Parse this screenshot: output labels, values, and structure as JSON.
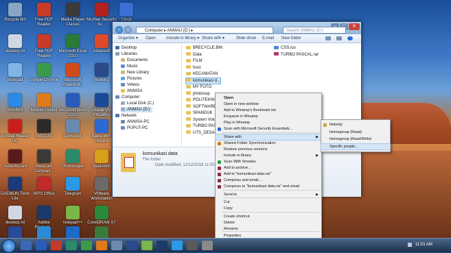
{
  "desktop": {
    "icons": [
      {
        "label": "Recycle Bin",
        "color": "#8aa4c4"
      },
      {
        "label": "Free PDF Reader",
        "color": "#c83a2a"
      },
      {
        "label": "Media Player Classic",
        "color": "#3a3a3a"
      },
      {
        "label": "McAfee Security Sc...",
        "color": "#b42020"
      },
      {
        "label": "Clock",
        "color": "#3a6fd6"
      },
      {
        "label": "desktop.ini",
        "color": "#cfd8e2"
      },
      {
        "label": "Free PDF Reader",
        "color": "#c83a2a"
      },
      {
        "label": "Microsoft Excel 2010",
        "color": "#2a7a3a"
      },
      {
        "label": "Aiseesoft",
        "color": "#e04a2a"
      },
      {
        "label": "Notepad",
        "color": "#7fb6e6"
      },
      {
        "label": "Google Chrome",
        "color": "#3a9a4a"
      },
      {
        "label": "Microsoft PowerPoi...",
        "color": "#d04a1a"
      },
      {
        "label": "Booking",
        "color": "#2a4a8a"
      },
      {
        "label": "SHAREit",
        "color": "#2a8ae6"
      },
      {
        "label": "Mozilla Firefox",
        "color": "#e07a1a"
      },
      {
        "label": "Microsoft Word 2010",
        "color": "#2a5aba"
      },
      {
        "label": "Oracle VM VirtualBox",
        "color": "#1a4a9a"
      },
      {
        "label": "Acrobat Reader DC",
        "color": "#c81e1e"
      },
      {
        "label": "SMADAV",
        "color": "#2a2a2a"
      },
      {
        "label": "Computer",
        "color": "#6a8ab0"
      },
      {
        "label": "Baidu WiFi Hotspot",
        "color": "#2a6ad6"
      },
      {
        "label": "AudioWizard",
        "color": "#5a1a1a"
      },
      {
        "label": "WebCam Compani...",
        "color": "#3a3a3a"
      },
      {
        "label": "Photoscape",
        "color": "#2a8a6a"
      },
      {
        "label": "BaiduWifi",
        "color": "#d6a01a"
      },
      {
        "label": "DAEMON Tools Lite",
        "color": "#1a3a7a"
      },
      {
        "label": "WPS Office",
        "color": "#c02a2a"
      },
      {
        "label": "Telegram",
        "color": "#2a9ae6"
      },
      {
        "label": "VMware Workstation",
        "color": "#6a6a6a"
      },
      {
        "label": "desktop.ini",
        "color": "#cfd8e2"
      },
      {
        "label": "Adobe Photosh...",
        "color": "#1a3a6a"
      },
      {
        "label": "notepad++",
        "color": "#7ab64a"
      },
      {
        "label": "CorelDRAW X7",
        "color": "#2a8a3a"
      },
      {
        "label": "EPSON Manuals",
        "color": "#2a4a9a"
      },
      {
        "label": "Internet Downlo...",
        "color": "#2a8ad6"
      },
      {
        "label": "Internet Explorer",
        "color": "#1a6ac6"
      },
      {
        "label": "Corel PHOTO-P...",
        "color": "#3a7a3a"
      }
    ]
  },
  "window": {
    "address": "Computer ▸ ANMAU (D:) ▸",
    "search_placeholder": "Search ANMAU (D:)",
    "toolbar": [
      "Organize ▾",
      "Open",
      "Include in library ▾",
      "Share with ▾",
      "Slide show",
      "E-mail",
      "New folder"
    ],
    "nav": [
      {
        "label": "Desktop",
        "color": "#3a6ab6"
      },
      {
        "label": "Libraries",
        "color": "#8a9ab6"
      },
      {
        "label": "Documents",
        "color": "#c9b67a"
      },
      {
        "label": "Music",
        "color": "#6a8ad6"
      },
      {
        "label": "New Library",
        "color": "#c9b67a"
      },
      {
        "label": "Pictures",
        "color": "#6aa6d6"
      },
      {
        "label": "Videos",
        "color": "#6a8ab6"
      },
      {
        "label": "ANNISA",
        "color": "#e6c25a"
      },
      {
        "label": "Computer",
        "color": "#6a8ab0"
      },
      {
        "label": "Local Disk (C:)",
        "color": "#9aaac0"
      },
      {
        "label": "ANMAU (D:)",
        "color": "#9aaac0"
      },
      {
        "label": "Network",
        "color": "#4a7ab6"
      },
      {
        "label": "ANNISA-PC",
        "color": "#6a8ab0"
      },
      {
        "label": "PUPUT-PC",
        "color": "#6a8ab0"
      }
    ],
    "files_col1": [
      "$RECYCLE.BIN",
      "Data",
      "FILM",
      "host",
      "KECAMATAN",
      "komunikasi d...",
      "MY FOTO",
      "photosop",
      "POLITEKNIK S",
      "SOFTWARE",
      "SPANDUK",
      "System Volum",
      "TURBO PASCA",
      "UTS_DESAIN"
    ],
    "files_col2": [
      "CSS.ico",
      "TURBO PASCAL.rar"
    ],
    "details": {
      "name": "komunikasi data",
      "type": "File folder",
      "modified": "Date modified: 12/12/2018 11:50"
    }
  },
  "context_menu": {
    "items": [
      "Open",
      "Open in new window",
      "Add to Winamp's Bookmark list",
      "Enqueue in Winamp",
      "Play in Winamp",
      "Scan with Microsoft Security Essentials...",
      "Share with",
      "Shared Folder Synchronization",
      "Restore previous versions",
      "Include in library",
      "Scan With Smadav",
      "Add to archive...",
      "Add to \"komunikasi data.rar\"",
      "Compress and email...",
      "Compress to \"komunikasi data.rar\" and email",
      "Send to",
      "Cut",
      "Copy",
      "Create shortcut",
      "Delete",
      "Rename",
      "Properties"
    ]
  },
  "share_submenu": {
    "items": [
      "Nobody",
      "Homegroup (Read)",
      "Homegroup (Read/Write)",
      "Specific people..."
    ]
  },
  "taskbar": {
    "clock": "11:51 AM"
  }
}
